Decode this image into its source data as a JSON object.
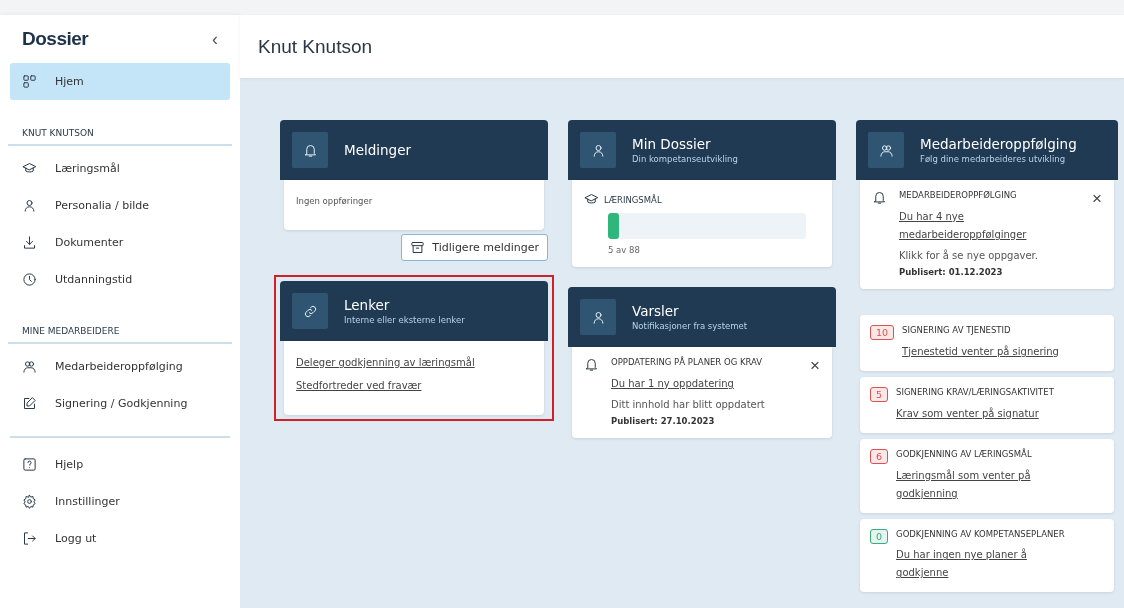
{
  "sidebar": {
    "logo": "Dossier",
    "collapse": "‹",
    "home": {
      "label": "Hjem",
      "selected": true
    },
    "sections": [
      {
        "heading": "KNUT KNUTSON",
        "items": [
          {
            "label": "Læringsmål",
            "selected": false
          },
          {
            "label": "Personalia / bilde",
            "selected": false
          },
          {
            "label": "Dokumenter",
            "selected": false
          },
          {
            "label": "Utdanningstid",
            "selected": false
          }
        ]
      },
      {
        "heading": "MINE MEDARBEIDERE",
        "items": [
          {
            "label": "Medarbeideroppfølging",
            "selected": false
          },
          {
            "label": "Signering / Godkjenning",
            "selected": false
          }
        ]
      },
      {
        "items": [
          {
            "label": "Hjelp",
            "selected": false
          },
          {
            "label": "Innstillinger",
            "selected": false
          },
          {
            "label": "Logg ut",
            "selected": false
          }
        ]
      }
    ]
  },
  "header": {
    "title": "Knut Knutson"
  },
  "columns": [
    {
      "cards": [
        {
          "kind": "messages",
          "title": "Meldinger",
          "empty_text": "Ingen oppføringer",
          "button": "Tidligere meldinger"
        },
        {
          "kind": "links",
          "title": "Lenker",
          "subtitle": "Interne eller eksterne lenker",
          "highlighted": true,
          "links": [
            "Deleger godkjenning av læringsmål",
            "Stedfortreder ved fravær"
          ]
        }
      ]
    },
    {
      "cards": [
        {
          "kind": "progress",
          "title": "Min Dossier",
          "subtitle": "Din kompetanseutvikling",
          "label": "LÆRINGSMÅL",
          "level": 0.057,
          "reading": "5 av 88"
        },
        {
          "kind": "alerts",
          "title": "Varsler",
          "subtitle": "Notifikasjoner fra systemet",
          "alert": {
            "heading": "OPPDATERING PÅ PLANER OG KRAV",
            "link": "Du har 1 ny oppdatering",
            "text": "Ditt innhold har blitt oppdatert",
            "published": "Publisert: 27.10.2023",
            "close": "×"
          }
        }
      ]
    },
    {
      "cards": [
        {
          "kind": "followup",
          "title": "Medarbeideroppfølging",
          "subtitle": "Følg dine medarbeideres utvikling",
          "alert": {
            "heading": "MEDARBEIDEROPPFØLGING",
            "link": "Du har 4 nye medarbeideroppfølginger",
            "text": "Klikk for å se nye oppgaver.",
            "published": "Publisert: 01.12.2023",
            "close": "×"
          },
          "tasks": [
            {
              "count": "10",
              "color": "#d9534f",
              "heading": "SIGNERING AV TJENESTID",
              "link": "Tjenestetid venter på signering"
            },
            {
              "count": "5",
              "color": "#d9534f",
              "heading": "SIGNERING KRAV/LÆRINGSAKTIVITET",
              "link": "Krav som venter på signatur"
            },
            {
              "count": "6",
              "color": "#d9534f",
              "heading": "GODKJENNING AV LÆRINGSMÅL",
              "link": "Læringsmål som venter på godkjenning"
            },
            {
              "count": "0",
              "color": "#3aaa80",
              "heading": "GODKJENNING AV KOMPETANSEPLANER",
              "link": "Du har ingen nye planer å godkjenne"
            }
          ]
        }
      ]
    }
  ]
}
